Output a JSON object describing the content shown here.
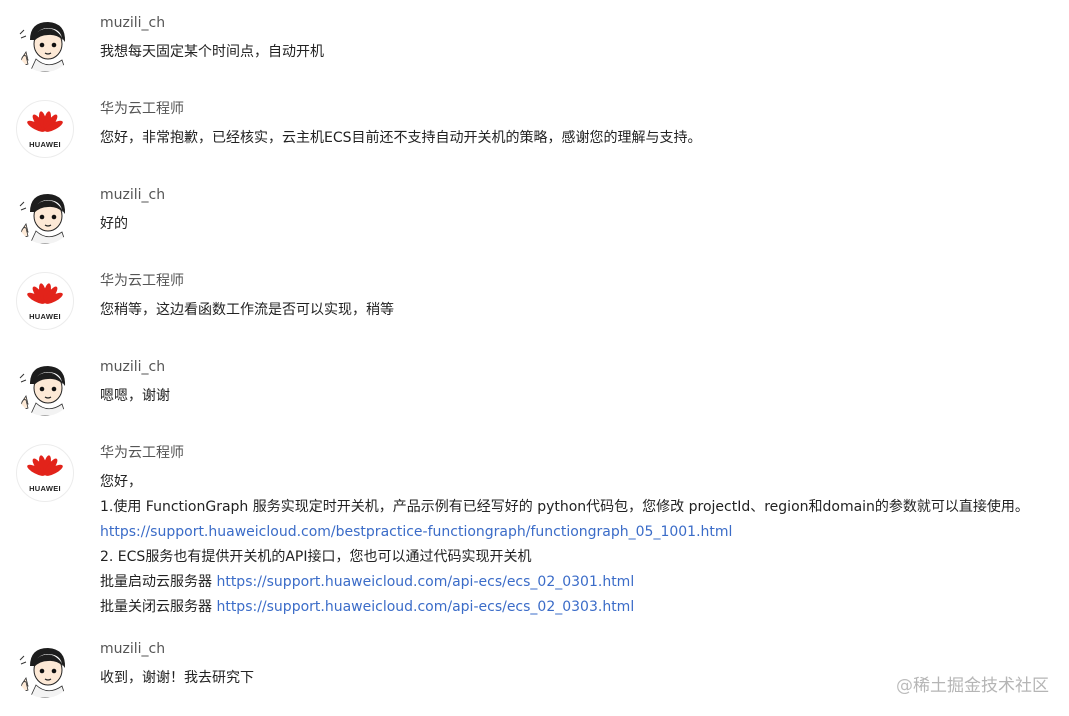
{
  "messages": [
    {
      "sender": "muzili_ch",
      "avatar": "user-avatar",
      "lines": [
        [
          {
            "t": "我想每天固定某个时间点，自动开机"
          }
        ]
      ]
    },
    {
      "sender": "华为云工程师",
      "avatar": "huawei-avatar",
      "lines": [
        [
          {
            "t": "您好，非常抱歉，已经核实，云主机ECS目前还不支持自动开关机的策略，感谢您的理解与支持。"
          }
        ]
      ]
    },
    {
      "sender": "muzili_ch",
      "avatar": "user-avatar",
      "lines": [
        [
          {
            "t": "好的"
          }
        ]
      ]
    },
    {
      "sender": "华为云工程师",
      "avatar": "huawei-avatar",
      "lines": [
        [
          {
            "t": "您稍等，这边看函数工作流是否可以实现，稍等"
          }
        ]
      ]
    },
    {
      "sender": "muzili_ch",
      "avatar": "user-avatar",
      "lines": [
        [
          {
            "t": "嗯嗯，谢谢"
          }
        ]
      ]
    },
    {
      "sender": "华为云工程师",
      "avatar": "huawei-avatar",
      "lines": [
        [
          {
            "t": "您好，"
          }
        ],
        [
          {
            "t": "1.使用 FunctionGraph 服务实现定时开关机，产品示例有已经写好的 python代码包，您修改 projectId、region和domain的参数就可以直接使用。"
          }
        ],
        [
          {
            "t": "https://support.huaweicloud.com/bestpractice-functiongraph/functiongraph_05_1001.html",
            "link": true
          }
        ],
        [
          {
            "t": "2. ECS服务也有提供开关机的API接口，您也可以通过代码实现开关机"
          }
        ],
        [
          {
            "t": "批量启动云服务器 "
          },
          {
            "t": "https://support.huaweicloud.com/api-ecs/ecs_02_0301.html",
            "link": true
          }
        ],
        [
          {
            "t": "批量关闭云服务器 "
          },
          {
            "t": "https://support.huaweicloud.com/api-ecs/ecs_02_0303.html",
            "link": true
          }
        ]
      ]
    },
    {
      "sender": "muzili_ch",
      "avatar": "user-avatar",
      "lines": [
        [
          {
            "t": "收到，谢谢！我去研究下"
          }
        ]
      ]
    }
  ],
  "huawei_logo_text": "HUAWEI",
  "watermark": {
    "at": "@",
    "text": "稀土掘金技术社区"
  },
  "colors": {
    "link": "#3b6cc8",
    "huawei_red": "#e2231a"
  }
}
